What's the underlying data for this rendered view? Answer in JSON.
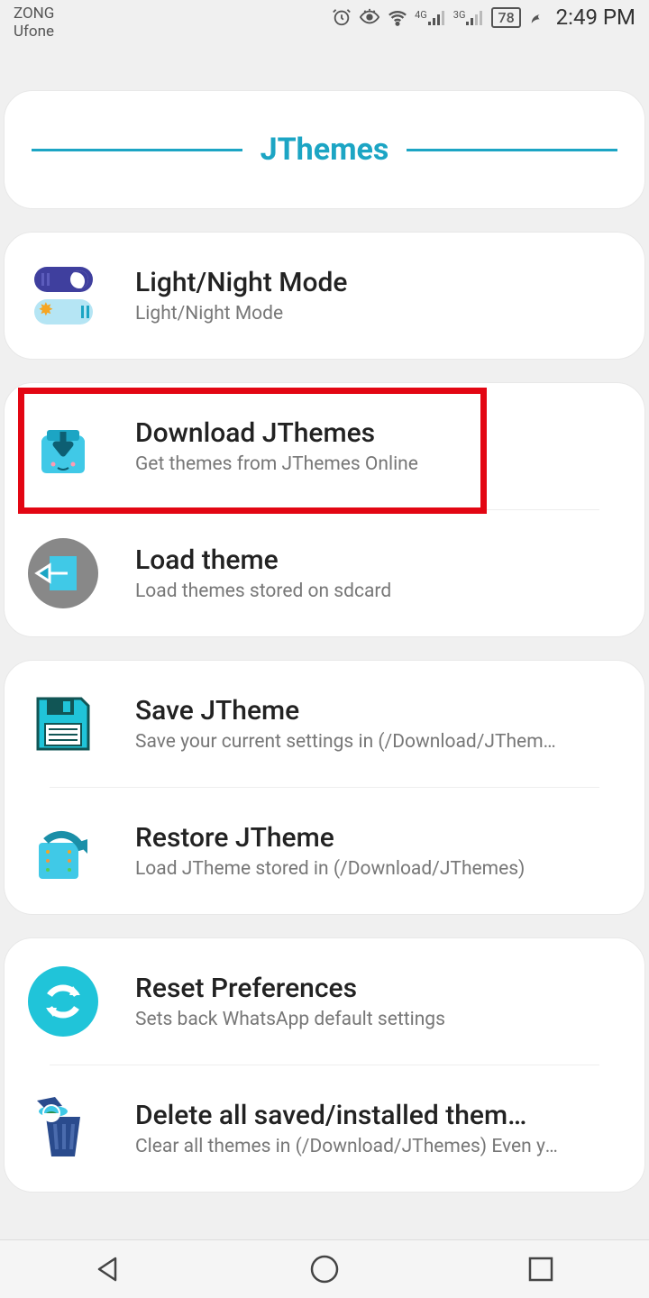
{
  "status": {
    "carrier1": "ZONG",
    "carrier2": "Ufone",
    "battery": "78",
    "time": "2:49 PM",
    "sig1": "4G",
    "sig2": "3G"
  },
  "header": {
    "title": "JThemes"
  },
  "items": {
    "lightNight": {
      "title": "Light/Night Mode",
      "subtitle": "Light/Night Mode"
    },
    "download": {
      "title": "Download JThemes",
      "subtitle": "Get themes from JThemes Online"
    },
    "load": {
      "title": "Load theme",
      "subtitle": "Load themes stored on sdcard"
    },
    "save": {
      "title": "Save JTheme",
      "subtitle": "Save your current settings in (/Download/JThemes)"
    },
    "restore": {
      "title": "Restore JTheme",
      "subtitle": "Load JTheme stored in (/Download/JThemes)"
    },
    "reset": {
      "title": "Reset Preferences",
      "subtitle": "Sets back WhatsApp default settings"
    },
    "delete": {
      "title": "Delete all saved/installed them…",
      "subtitle": "Clear all themes in (/Download/JThemes) Even yo…"
    }
  }
}
